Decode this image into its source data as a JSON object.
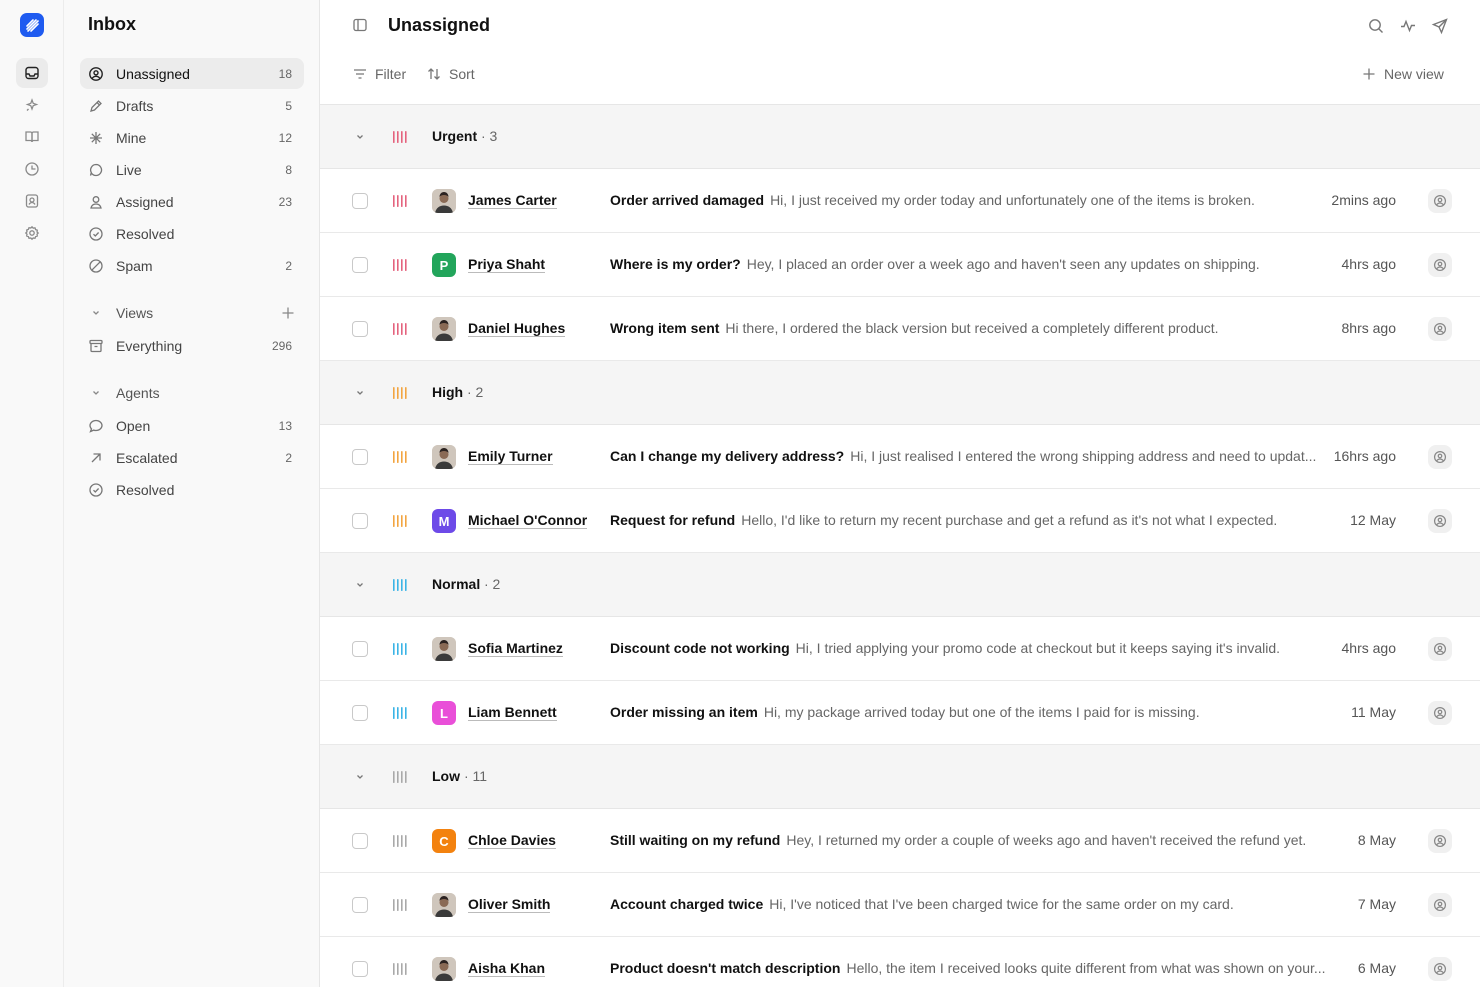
{
  "rail": {
    "items": [
      {
        "icon": "inbox-icon",
        "active": true
      },
      {
        "icon": "sparkle-icon",
        "active": false
      },
      {
        "icon": "book-icon",
        "active": false
      },
      {
        "icon": "clock-icon",
        "active": false
      },
      {
        "icon": "contact-icon",
        "active": false
      },
      {
        "icon": "gear-icon",
        "active": false
      }
    ]
  },
  "sidebar": {
    "title": "Inbox",
    "items": [
      {
        "label": "Unassigned",
        "count": "18",
        "icon": "user-circle-icon",
        "active": true
      },
      {
        "label": "Drafts",
        "count": "5",
        "icon": "pencil-icon"
      },
      {
        "label": "Mine",
        "count": "12",
        "icon": "asterisk-icon"
      },
      {
        "label": "Live",
        "count": "8",
        "icon": "chat-bubble-icon"
      },
      {
        "label": "Assigned",
        "count": "23",
        "icon": "user-icon"
      },
      {
        "label": "Resolved",
        "count": "",
        "icon": "check-circle-icon"
      },
      {
        "label": "Spam",
        "count": "2",
        "icon": "ban-icon"
      }
    ],
    "views": {
      "label": "Views",
      "items": [
        {
          "label": "Everything",
          "count": "296",
          "icon": "archive-icon"
        }
      ]
    },
    "agents": {
      "label": "Agents",
      "items": [
        {
          "label": "Open",
          "count": "13",
          "icon": "message-circle-icon"
        },
        {
          "label": "Escalated",
          "count": "2",
          "icon": "arrow-up-right-icon"
        },
        {
          "label": "Resolved",
          "count": "",
          "icon": "check-circle-icon"
        }
      ]
    }
  },
  "header": {
    "title": "Unassigned",
    "filter_label": "Filter",
    "sort_label": "Sort",
    "new_view_label": "New view"
  },
  "colors": {
    "urgent": "#e4637e",
    "high": "#f2a541",
    "normal": "#3bb4e6",
    "low": "#a9a9a9",
    "brand": "#1f5bf0"
  },
  "groups": [
    {
      "name": "Urgent",
      "count": "· 3",
      "priority": "urgent",
      "tickets": [
        {
          "customer": "James Carter",
          "avatar": "photo",
          "subject": "Order arrived damaged",
          "snippet": "Hi, I just received my order today and unfortunately one of the items is broken.",
          "time": "2mins ago"
        },
        {
          "customer": "Priya Shaht",
          "avatar": "letter",
          "initial": "P",
          "avatar_color": "#22a55b",
          "subject": "Where is my order?",
          "snippet": "Hey, I placed an order over a week ago and haven't seen any updates on shipping.",
          "time": "4hrs ago"
        },
        {
          "customer": "Daniel Hughes",
          "avatar": "photo",
          "subject": "Wrong item sent",
          "snippet": "Hi there, I ordered the black version but received a completely different product.",
          "time": "8hrs ago"
        }
      ]
    },
    {
      "name": "High",
      "count": "· 2",
      "priority": "high",
      "tickets": [
        {
          "customer": "Emily Turner",
          "avatar": "photo",
          "subject": "Can I change my delivery address?",
          "snippet": "Hi, I just realised I entered the wrong shipping address and need to updat...",
          "time": "16hrs ago"
        },
        {
          "customer": "Michael O'Connor",
          "avatar": "letter",
          "initial": "M",
          "avatar_color": "#6d4ae8",
          "subject": "Request for refund",
          "snippet": "Hello, I'd like to return my recent purchase and get a refund as it's not what I expected.",
          "time": "12 May"
        }
      ]
    },
    {
      "name": "Normal",
      "count": "· 2",
      "priority": "normal",
      "tickets": [
        {
          "customer": "Sofia Martinez",
          "avatar": "photo",
          "subject": "Discount code not working",
          "snippet": "Hi, I tried applying your promo code at checkout but it keeps saying it's invalid.",
          "time": "4hrs ago"
        },
        {
          "customer": "Liam Bennett",
          "avatar": "letter",
          "initial": "L",
          "avatar_color": "#e94fd8",
          "subject": "Order missing an item",
          "snippet": "Hi, my package arrived today but one of the items I paid for is missing.",
          "time": "11 May"
        }
      ]
    },
    {
      "name": "Low",
      "count": "· 11",
      "priority": "low",
      "tickets": [
        {
          "customer": "Chloe Davies",
          "avatar": "letter",
          "initial": "C",
          "avatar_color": "#f3820f",
          "subject": "Still waiting on my refund",
          "snippet": "Hey, I returned my order a couple of weeks ago and haven't received the refund yet.",
          "time": "8 May"
        },
        {
          "customer": "Oliver Smith",
          "avatar": "photo",
          "subject": "Account charged twice",
          "snippet": "Hi, I've noticed that I've been charged twice for the same order on my card.",
          "time": "7 May"
        },
        {
          "customer": "Aisha Khan",
          "avatar": "photo",
          "subject": "Product doesn't match description",
          "snippet": "Hello, the item I received looks quite different from what was shown on your...",
          "time": "6 May"
        }
      ]
    }
  ]
}
